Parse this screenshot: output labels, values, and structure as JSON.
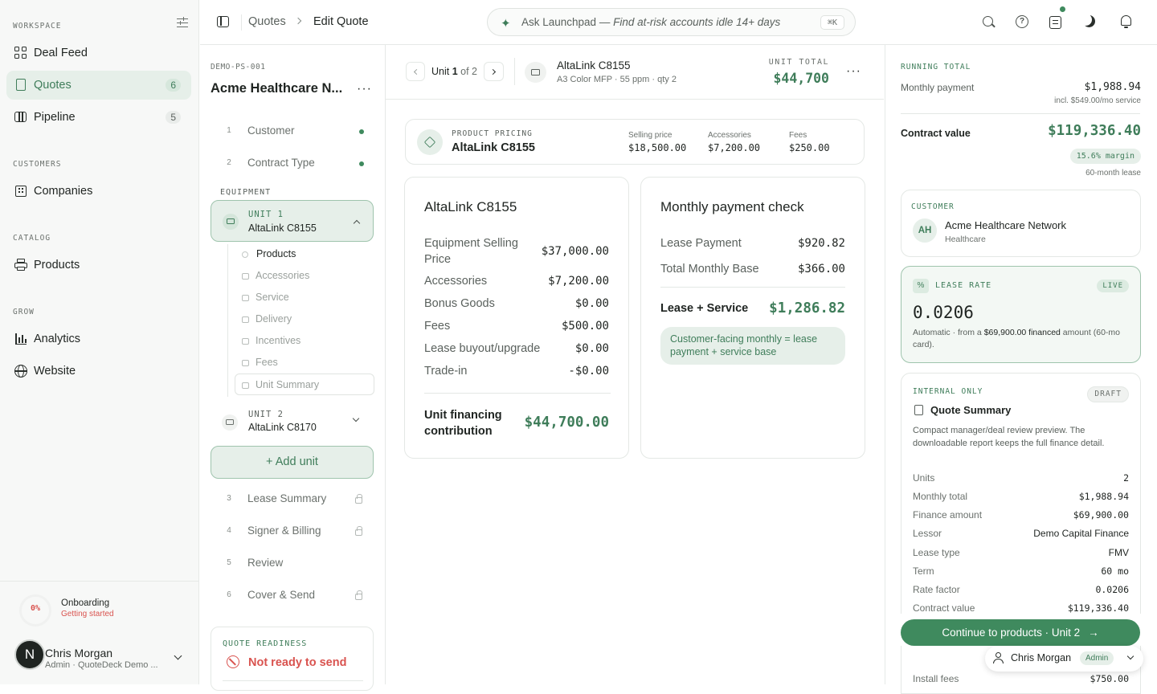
{
  "nav": {
    "workspace_label": "WORKSPACE",
    "customers_label": "CUSTOMERS",
    "catalog_label": "CATALOG",
    "grow_label": "GROW",
    "items": {
      "deal_feed": "Deal Feed",
      "quotes": "Quotes",
      "quotes_count": "6",
      "pipeline": "Pipeline",
      "pipeline_count": "5",
      "companies": "Companies",
      "products": "Products",
      "analytics": "Analytics",
      "website": "Website"
    },
    "onboarding": {
      "percent": "0%",
      "title": "Onboarding",
      "status": "Getting started",
      "progress": 0
    },
    "user": {
      "initial": "N",
      "name": "Chris Morgan",
      "role": "Admin · QuoteDeck Demo ..."
    }
  },
  "header": {
    "breadcrumb_parent": "Quotes",
    "breadcrumb_current": "Edit Quote",
    "search_prefix": "Ask Launchpad — ",
    "search_hint": "Find at-risk accounts idle 14+ days",
    "shortcut": "⌘K"
  },
  "quote": {
    "id": "DEMO-PS-001",
    "customer_name": "Acme Healthcare N...",
    "steps": {
      "s1": {
        "num": "1",
        "label": "Customer"
      },
      "s2": {
        "num": "2",
        "label": "Contract Type"
      },
      "s3": {
        "num": "3",
        "label": "Lease Summary"
      },
      "s4": {
        "num": "4",
        "label": "Signer & Billing"
      },
      "s5": {
        "num": "5",
        "label": "Review"
      },
      "s6": {
        "num": "6",
        "label": "Cover & Send"
      }
    },
    "equipment_label": "EQUIPMENT",
    "unit1": {
      "label": "UNIT 1",
      "name": "AltaLink C8155"
    },
    "unit1_subs": {
      "products": "Products",
      "accessories": "Accessories",
      "service": "Service",
      "delivery": "Delivery",
      "incentives": "Incentives",
      "fees": "Fees",
      "unit_summary": "Unit Summary"
    },
    "unit2": {
      "label": "UNIT 2",
      "name": "AltaLink C8170"
    },
    "add_unit": "+ Add unit",
    "readiness": {
      "label": "QUOTE READINESS",
      "status": "Not ready to send"
    }
  },
  "unit_bar": {
    "unit_word": "Unit ",
    "unit_num": "1",
    "of_text": " of 2",
    "product_name": "AltaLink C8155",
    "product_detail": "A3 Color MFP · 55 ppm · qty 2",
    "total_label": "UNIT TOTAL",
    "total_value": "$44,700"
  },
  "pricing": {
    "label": "PRODUCT PRICING",
    "name": "AltaLink C8155",
    "selling_label": "Selling price",
    "selling_value": "$18,500.00",
    "acc_label": "Accessories",
    "acc_value": "$7,200.00",
    "fees_label": "Fees",
    "fees_value": "$250.00"
  },
  "unit_card": {
    "title": "AltaLink C8155",
    "rows": {
      "equip_label": "Equipment Selling Price",
      "equip_value": "$37,000.00",
      "acc_label": "Accessories",
      "acc_value": "$7,200.00",
      "bonus_label": "Bonus Goods",
      "bonus_value": "$0.00",
      "fees_label": "Fees",
      "fees_value": "$500.00",
      "buyout_label": "Lease buyout/upgrade",
      "buyout_value": "$0.00",
      "trade_label": "Trade-in",
      "trade_value": "-$0.00"
    },
    "contribution_label": "Unit financing contribution",
    "contribution_value": "$44,700.00"
  },
  "payment_card": {
    "title": "Monthly payment check",
    "lease_label": "Lease Payment",
    "lease_value": "$920.82",
    "base_label": "Total Monthly Base",
    "base_value": "$366.00",
    "total_label": "Lease + Service",
    "total_value": "$1,286.82",
    "note": "Customer-facing monthly = lease payment + service base"
  },
  "running": {
    "label": "RUNNING TOTAL",
    "monthly_label": "Monthly payment",
    "monthly_value": "$1,988.94",
    "service_note": "incl. $549.00/mo service",
    "contract_label": "Contract value",
    "contract_value": "$119,336.40",
    "margin": "15.6% margin",
    "term_note": "60-month lease"
  },
  "customer_card": {
    "label": "CUSTOMER",
    "initials": "AH",
    "name": "Acme Healthcare Network",
    "industry": "Healthcare"
  },
  "lease_card": {
    "icon": "%",
    "label": "LEASE RATE",
    "badge": "LIVE",
    "value": "0.0206",
    "desc1": "Automatic · from a ",
    "desc_amount": "$69,900.00 financed",
    "desc2": " amount (60-mo card)."
  },
  "summary_card": {
    "label": "INTERNAL ONLY",
    "badge": "DRAFT",
    "title": "Quote Summary",
    "desc": "Compact manager/deal review preview. The downloadable report keeps the full finance detail.",
    "rows": {
      "units_label": "Units",
      "units_value": "2",
      "monthly_label": "Monthly total",
      "monthly_value": "$1,988.94",
      "finance_label": "Finance amount",
      "finance_value": "$69,900.00",
      "lessor_label": "Lessor",
      "lessor_value": "Demo Capital Finance",
      "type_label": "Lease type",
      "type_value": "FMV",
      "term_label": "Term",
      "term_value": "60 mo",
      "rate_label": "Rate factor",
      "rate_value": "0.0206",
      "contract_label": "Contract value",
      "contract_value": "$119,336.40",
      "install_label": "Install fees",
      "install_value": "$750.00"
    }
  },
  "continue_button": "Continue to products · Unit 2",
  "user_chip": {
    "name": "Chris Morgan",
    "badge": "Admin"
  },
  "colors": {
    "accent": "#3f7d5a",
    "accent_light": "#e6efe9",
    "danger": "#d9534f"
  }
}
